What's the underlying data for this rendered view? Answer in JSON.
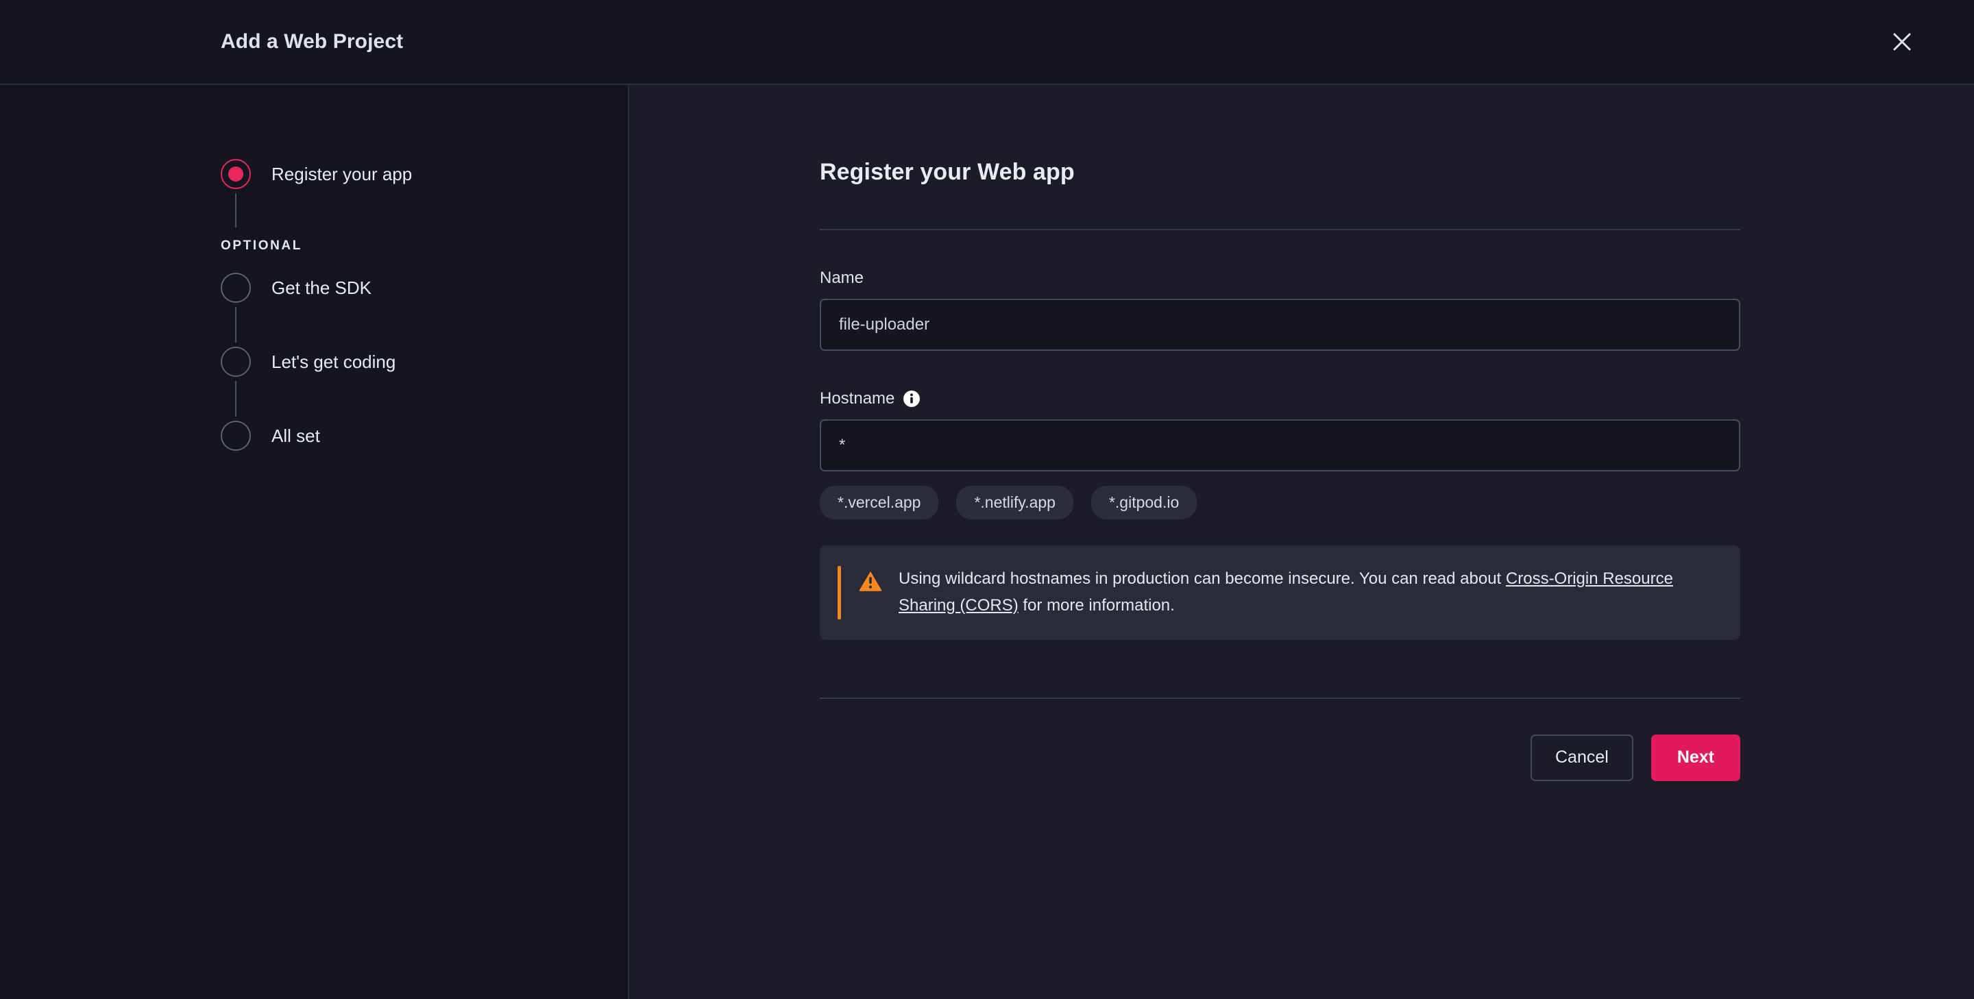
{
  "header": {
    "title": "Add a Web Project",
    "close_icon": "close-icon"
  },
  "stepper": {
    "optional_label": "OPTIONAL",
    "steps": [
      {
        "label": "Register your app",
        "state": "active",
        "group": "required"
      },
      {
        "label": "Get the SDK",
        "state": "inactive",
        "group": "optional"
      },
      {
        "label": "Let's get coding",
        "state": "inactive",
        "group": "optional"
      },
      {
        "label": "All set",
        "state": "inactive",
        "group": "optional"
      }
    ]
  },
  "form": {
    "title": "Register your Web app",
    "name_field": {
      "label": "Name",
      "value": "file-uploader",
      "placeholder": "Name"
    },
    "hostname_field": {
      "label": "Hostname",
      "info_icon": "info-icon",
      "value": "*",
      "placeholder": "Hostname",
      "suggestions": [
        "*.vercel.app",
        "*.netlify.app",
        "*.gitpod.io"
      ]
    },
    "warning": {
      "icon": "warning-triangle-icon",
      "text_before": "Using wildcard hostnames in production can become insecure. You can read about ",
      "link_text": "Cross-Origin Resource Sharing (CORS)",
      "text_after": " for more information."
    },
    "actions": {
      "cancel_label": "Cancel",
      "next_label": "Next"
    }
  },
  "colors": {
    "accent_pink": "#e01a5b",
    "step_active": "#e8275c",
    "warning_orange": "#f7871f",
    "panel_dark": "#14151f",
    "panel_right": "#1b1c27"
  }
}
